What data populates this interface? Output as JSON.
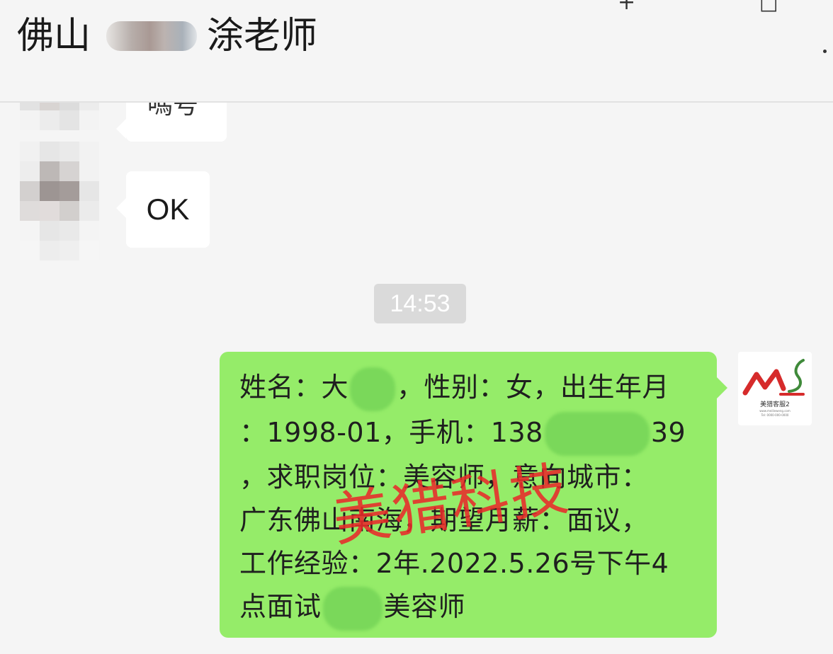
{
  "header": {
    "title_prefix": "佛山",
    "title_suffix": "涂老师",
    "pin_icon": "+",
    "maximize_icon": "□"
  },
  "messages": {
    "partial_received_text": "嗎号",
    "received_ok": "OK",
    "timestamp": "14:53",
    "sent_lines": {
      "l1a": "姓名：大",
      "l1b": "，性别：女，出生年月",
      "l2a": "：1998-01，手机：138",
      "l2b": "39",
      "l3": "，求职岗位：美容师，意向城市：",
      "l4": "广东佛山南海，期望月薪：面议，",
      "l5": "工作经验：2年.2022.5.26号下午4",
      "l6a": "点面试",
      "l6b": "美容师"
    }
  },
  "watermark": "美猎科技",
  "logo": {
    "caption": "美猎客服2",
    "url_text": "www.meilieweng.com",
    "phone_text": "Tel: 0000-000-0000"
  }
}
